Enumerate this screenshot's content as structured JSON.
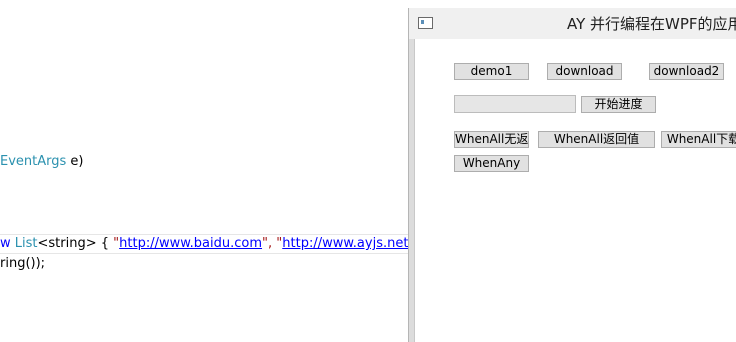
{
  "editor": {
    "line1": {
      "type": "EventArgs",
      "rest": " e)"
    },
    "line2": {
      "kw_new": "w",
      "type_list": "List",
      "generic": "<string> { ",
      "q1": "\"",
      "url1": "http://www.baidu.com",
      "q2": "\", \"",
      "url2": "http://www.ayjs.net/ind"
    },
    "line3": {
      "text": "ring());"
    }
  },
  "window": {
    "title": "AY 并行编程在WPF的应用"
  },
  "buttons": {
    "demo1": "demo1",
    "download": "download",
    "download2": "download2",
    "start_progress": "开始进度",
    "whenall_no_return": "WhenAll无返",
    "whenall_return": "WhenAll返回值",
    "whenall_download": "WhenAll下载",
    "whenany": "WhenAny"
  },
  "progress": {
    "value": 0
  },
  "colors": {
    "type": "#2b91af",
    "keyword": "#0000ff",
    "string": "#a31515",
    "button_bg": "#e1e1e1",
    "button_border": "#adadad",
    "window_bg": "#dcdcdc"
  },
  "icons": {
    "window": "window-app-icon"
  }
}
